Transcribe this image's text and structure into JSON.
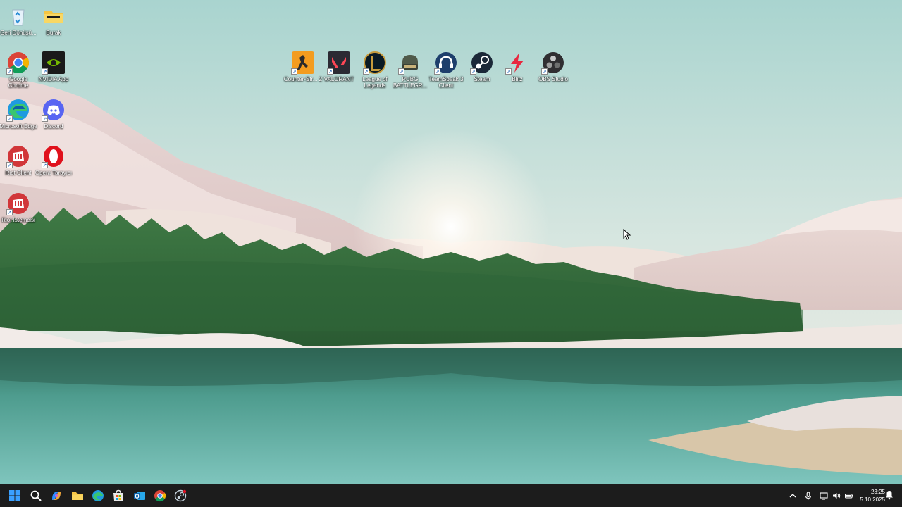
{
  "desktop": {
    "icons_left": [
      {
        "label": "Geri Dönüşü...",
        "icon": "recycle-bin-icon"
      },
      {
        "label": "Burak",
        "icon": "folder-icon"
      },
      {
        "label": "Google Chrome",
        "icon": "chrome-icon"
      },
      {
        "label": "NVIDIA App",
        "icon": "nvidia-icon"
      },
      {
        "label": "Microsoft Edge",
        "icon": "edge-icon"
      },
      {
        "label": "Discord",
        "icon": "discord-icon"
      },
      {
        "label": "Riot Client",
        "icon": "riot-client-icon"
      },
      {
        "label": "Opera Tarayıcı",
        "icon": "opera-icon"
      },
      {
        "label": "Riot İstemcisi",
        "icon": "riot-client-icon"
      }
    ],
    "icons_top": [
      {
        "label": "Counter-Str... 2",
        "icon": "counter-strike-icon"
      },
      {
        "label": "VALORANT",
        "icon": "valorant-icon"
      },
      {
        "label": "League of Legends",
        "icon": "league-of-legends-icon"
      },
      {
        "label": "PUBG BATTLEGR...",
        "icon": "pubg-icon"
      },
      {
        "label": "TeamSpeak 3 Client",
        "icon": "teamspeak-icon"
      },
      {
        "label": "Steam",
        "icon": "steam-icon"
      },
      {
        "label": "Blitz",
        "icon": "blitz-icon"
      },
      {
        "label": "OBS Studio",
        "icon": "obs-icon"
      }
    ]
  },
  "taskbar": {
    "apps": [
      "start-icon",
      "search-icon",
      "copilot-icon",
      "file-explorer-icon",
      "edge-icon",
      "store-icon",
      "outlook-icon",
      "chrome-icon",
      "steam-icon"
    ],
    "tray": [
      "chevron-up-icon",
      "microphone-icon",
      "display-icon",
      "speaker-icon",
      "battery-icon"
    ],
    "time": "23:25",
    "date": "5.10.2025"
  },
  "colors": {
    "taskbar_bg": "#1c1c1c",
    "accent": "#0078d4"
  }
}
